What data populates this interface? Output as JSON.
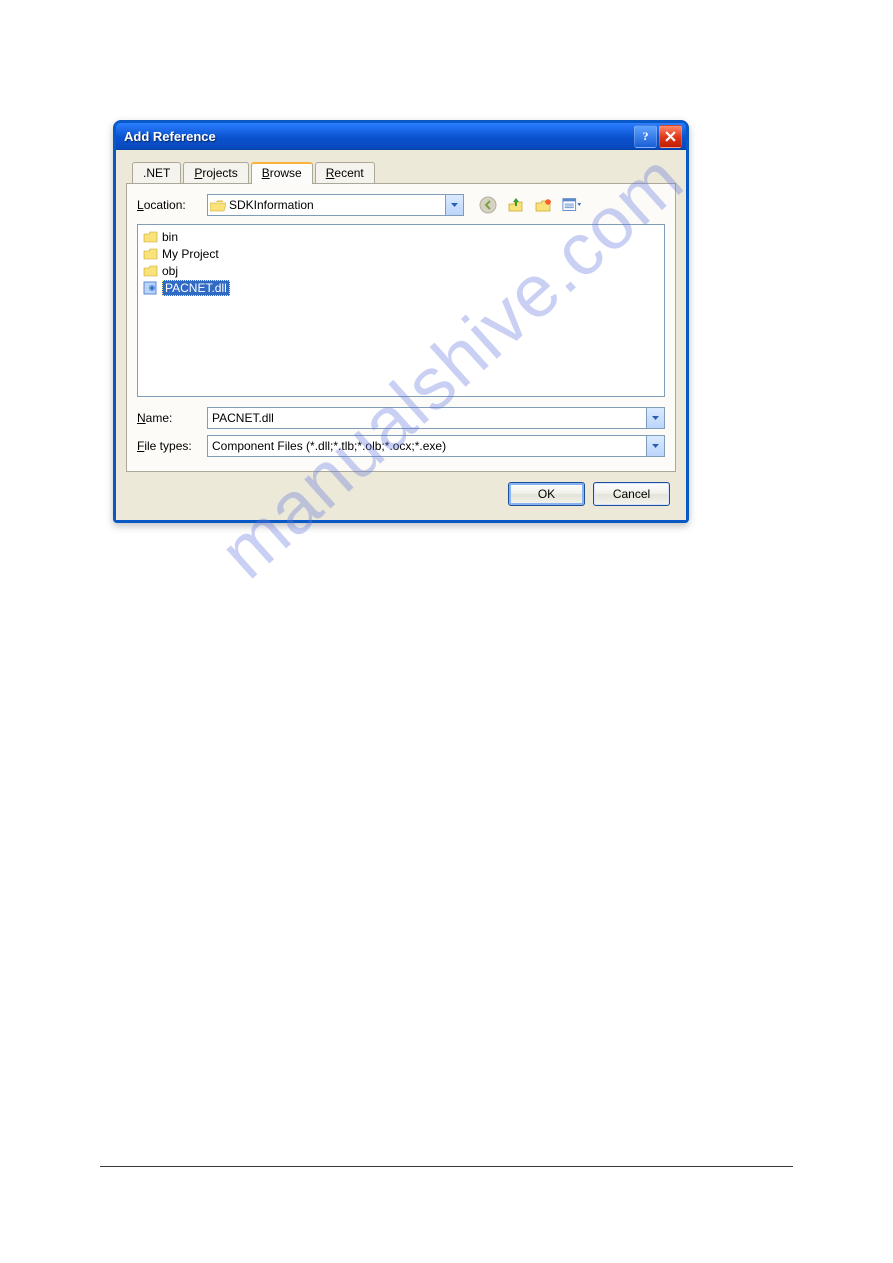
{
  "dialog": {
    "title": "Add Reference",
    "tabs": [
      {
        "label": ".NET",
        "active": false
      },
      {
        "label": "Projects",
        "mnemonic": "P",
        "active": false
      },
      {
        "label": "Browse",
        "mnemonic": "B",
        "active": true
      },
      {
        "label": "Recent",
        "mnemonic": "R",
        "active": false
      }
    ],
    "location_label": "Location:",
    "location_mnemonic": "L",
    "location_value": "SDKInformation",
    "toolbar": {
      "back": "back-icon",
      "up": "up-one-level-icon",
      "newfolder": "new-folder-icon",
      "views": "views-menu-icon"
    },
    "files": [
      {
        "name": "bin",
        "type": "folder",
        "selected": false
      },
      {
        "name": "My Project",
        "type": "folder",
        "selected": false
      },
      {
        "name": "obj",
        "type": "folder",
        "selected": false
      },
      {
        "name": "PACNET.dll",
        "type": "file",
        "selected": true
      }
    ],
    "name_label": "Name:",
    "name_mnemonic": "N",
    "name_value": "PACNET.dll",
    "filetypes_label": "File types:",
    "filetypes_mnemonic": "F",
    "filetypes_value": "Component Files (*.dll;*.tlb;*.olb;*.ocx;*.exe)",
    "ok_label": "OK",
    "cancel_label": "Cancel"
  },
  "watermark": "manualshive.com"
}
